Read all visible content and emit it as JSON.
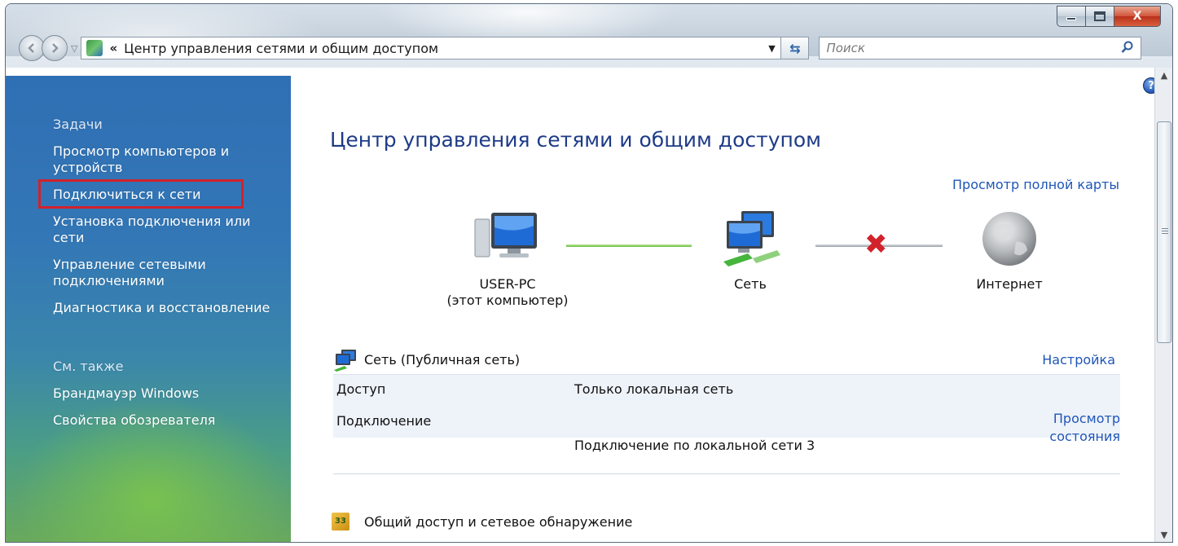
{
  "window": {
    "controls": {
      "minimize_icon": "minimize-icon",
      "maximize_icon": "maximize-icon",
      "close_icon": "close-icon",
      "close_label": "X"
    }
  },
  "navbar": {
    "back_icon": "back-arrow-icon",
    "forward_icon": "forward-arrow-icon",
    "address_chevrons": "«",
    "address_text": "Центр управления сетями и общим доступом",
    "search_placeholder": "Поиск"
  },
  "sidebar": {
    "tasks_heading": "Задачи",
    "items": [
      {
        "label": "Просмотр компьютеров и устройств"
      },
      {
        "label": "Подключиться к сети",
        "highlighted": true
      },
      {
        "label": "Установка подключения или сети"
      },
      {
        "label": "Управление сетевыми подключениями"
      },
      {
        "label": "Диагностика и восстановление"
      }
    ],
    "see_also_heading": "См. также",
    "see_also": [
      {
        "label": "Брандмауэр Windows"
      },
      {
        "label": "Свойства обозревателя"
      }
    ]
  },
  "main": {
    "title": "Центр управления сетями и общим доступом",
    "full_map_link": "Просмотр полной карты",
    "map": {
      "computer_name": "USER-PC",
      "computer_sub": "(этот компьютер)",
      "network_label": "Сеть",
      "internet_label": "Интернет",
      "internet_status": "disconnected"
    },
    "network": {
      "name": "Сеть (Публичная сеть)",
      "settings_link": "Настройка",
      "rows": [
        {
          "label": "Доступ",
          "value": "Только локальная сеть"
        },
        {
          "label": "Подключение",
          "value": "Подключение по локальной сети 3"
        }
      ],
      "status_link_line1": "Просмотр",
      "status_link_line2": "состояния"
    },
    "sharing_label": "Общий доступ и сетевое обнаружение"
  },
  "colors": {
    "link": "#1f56b8",
    "title": "#1e3b87",
    "highlight_border": "#d2222b",
    "sidebar_top": "#2f6fb4",
    "sidebar_bottom": "#6aa95c"
  }
}
